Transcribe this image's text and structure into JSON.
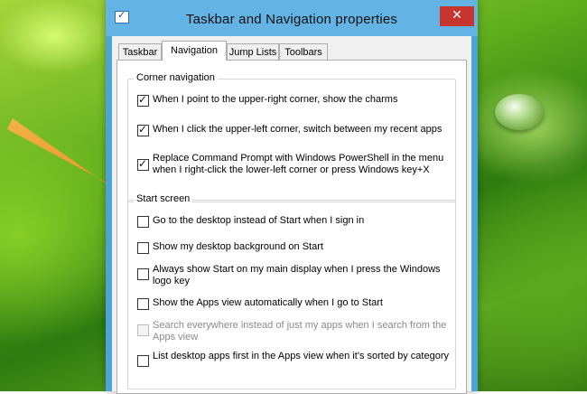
{
  "window": {
    "title": "Taskbar and Navigation properties",
    "close_glyph": "✕",
    "frame_color": "#4ca3d6",
    "close_color": "#c7352f"
  },
  "tabs": [
    {
      "label": "Taskbar",
      "active": false
    },
    {
      "label": "Navigation",
      "active": true
    },
    {
      "label": "Jump Lists",
      "active": false
    },
    {
      "label": "Toolbars",
      "active": false
    }
  ],
  "corner_navigation": {
    "label": "Corner navigation",
    "options": [
      {
        "label": "When I point to the upper-right corner, show the charms",
        "checked": true
      },
      {
        "label": "When I click the upper-left corner, switch between my recent apps",
        "checked": true
      },
      {
        "label": "Replace Command Prompt with Windows PowerShell in the menu when I right-click the lower-left corner or press Windows key+X",
        "checked": true
      }
    ]
  },
  "start_screen": {
    "label": "Start screen",
    "options": [
      {
        "label": "Go to the desktop instead of Start when I sign in",
        "checked": false,
        "disabled": false
      },
      {
        "label": "Show my desktop background on Start",
        "checked": false,
        "disabled": false
      },
      {
        "label": "Always show Start on my main display when I press the Windows logo key",
        "checked": false,
        "disabled": false
      },
      {
        "label": "Show the Apps view automatically when I go to Start",
        "checked": false,
        "disabled": false
      },
      {
        "label": "Search everywhere instead of just my apps when I search from the Apps view",
        "checked": false,
        "disabled": true
      },
      {
        "label": "List desktop apps first in the Apps view when it's sorted by category",
        "checked": false,
        "disabled": false
      }
    ]
  },
  "annotation": {
    "icon": "orange-arrow",
    "color": "#f59a2a"
  }
}
